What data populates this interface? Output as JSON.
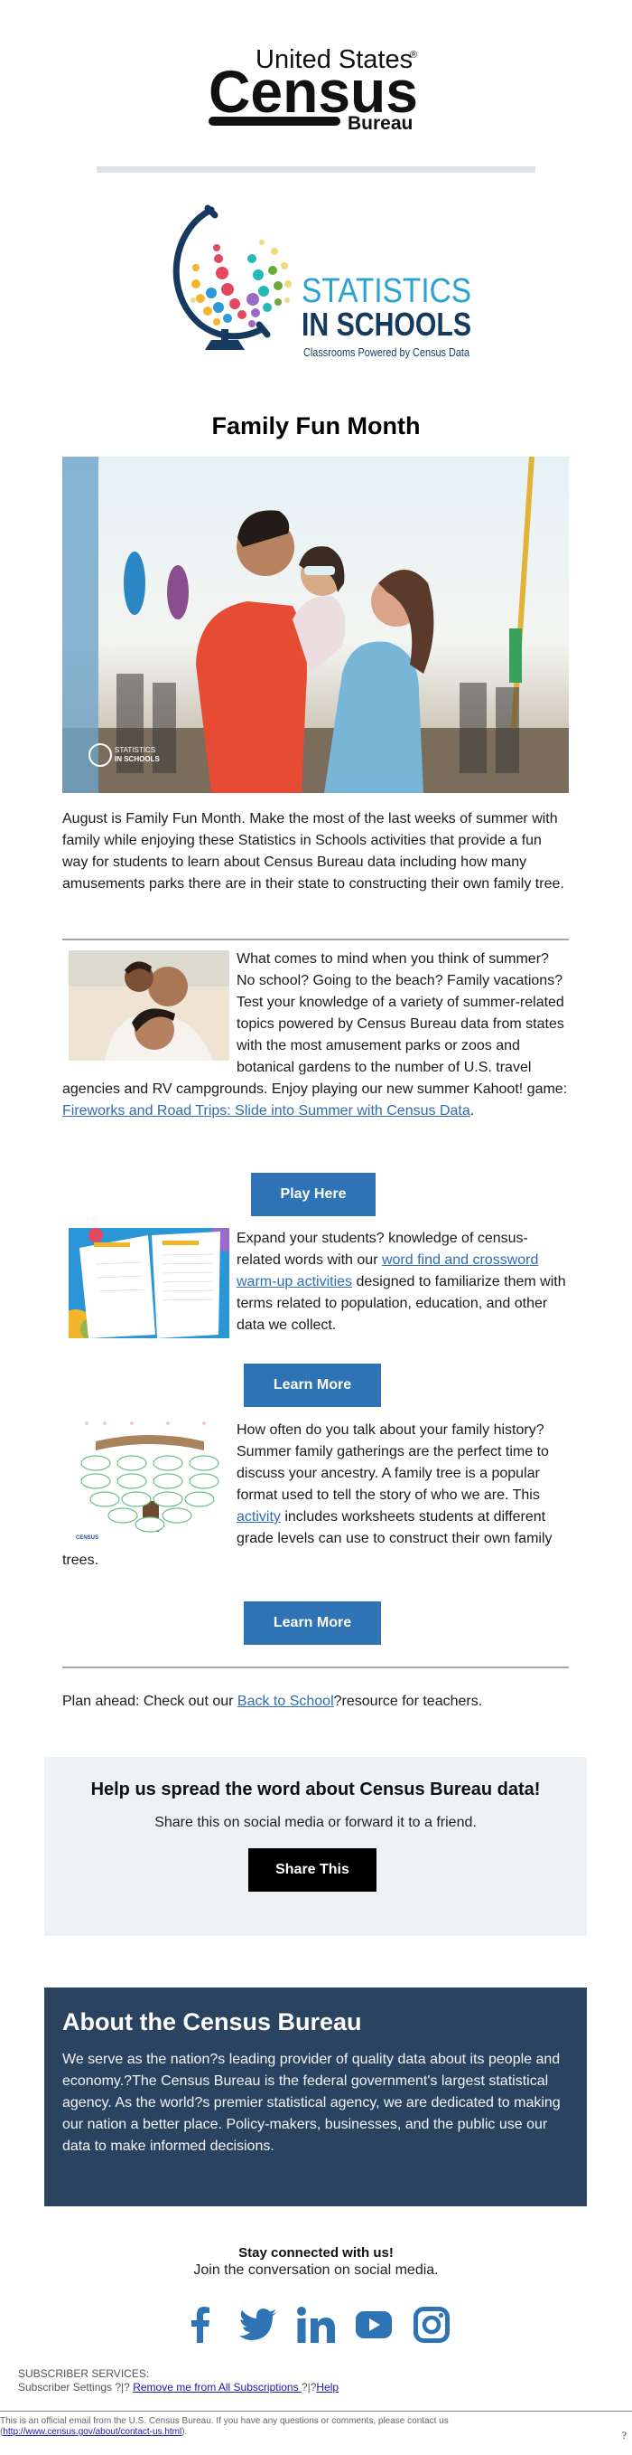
{
  "header": {
    "census_logo": {
      "line1": "United States",
      "registered": "®",
      "line2": "Census",
      "line3": "Bureau"
    },
    "sis_logo": {
      "line1": "STATISTICS",
      "line2": "IN SCHOOLS",
      "tagline": "Classrooms Powered by Census Data"
    }
  },
  "headline": "Family Fun Month",
  "hero": {
    "alt": "Family laughing together at an amusement park",
    "watermark_line1": "STATISTICS",
    "watermark_line2": "IN SCHOOLS"
  },
  "intro": "August is Family Fun Month. Make the most of the last weeks of summer with family while enjoying these Statistics in Schools activities that provide a fun way for students to learn about Census Bureau data including how many amusements parks there are in their state to constructing their own family tree.",
  "features": [
    {
      "image_alt": "Family smiling on the beach",
      "text_before": "What comes to mind when you think of summer? No school? Going to the beach? Family vacations? Test your knowledge of a variety of summer-related topics powered by Census Bureau data from states with the most amusement parks or zoos and botanical gardens to the number of U.S. travel agencies and RV campgrounds. Enjoy playing our new summer Kahoot! game: ",
      "link_text": "Fireworks and Road Trips: Slide into Summer with Census Data",
      "text_after": ".",
      "button_label": "Play Here"
    },
    {
      "image_alt": "Word find and crossword worksheets",
      "text_before": "Expand your students? knowledge of census-related words with our ",
      "link_text": "word find and crossword warm-up activities",
      "text_after": " designed to familiarize them with terms related to population, education, and other data we collect.",
      "button_label": "Learn More"
    },
    {
      "image_alt": "Family tree worksheet",
      "text_before": "How often do you talk about your family history? Summer family gatherings are the perfect time to discuss your ancestry. A family tree is a popular format used to tell the story of who we are. This ",
      "link_text": "activity",
      "text_after": " includes worksheets students at different grade levels can use to construct their own family trees.",
      "button_label": "Learn More"
    }
  ],
  "plan_ahead": {
    "text_before": "Plan ahead: Check out our ",
    "link_text": "Back to School",
    "text_after": "?resource for teachers."
  },
  "share": {
    "title": "Help us spread the word about Census Bureau data!",
    "subtitle": "Share this on social media or forward it to a friend.",
    "button_label": "Share This"
  },
  "about": {
    "title": "About the Census Bureau",
    "body": "We serve as the nation?s leading provider of quality data about its people and economy.?The Census Bureau is the federal government's largest statistical agency. As the world?s premier statistical agency, we are dedicated to making our nation a better place. Policy-makers, businesses, and the public use our data to make informed decisions."
  },
  "stay_connected": {
    "title": "Stay connected with us!",
    "subtitle": "Join the conversation on social media."
  },
  "social": [
    {
      "name": "facebook-icon"
    },
    {
      "name": "twitter-icon"
    },
    {
      "name": "linkedin-icon"
    },
    {
      "name": "youtube-icon"
    },
    {
      "name": "instagram-icon"
    }
  ],
  "subscriber": {
    "heading": "SUBSCRIBER SERVICES:",
    "settings": "Subscriber Settings ?|? ",
    "remove_link": "Remove me from All Subscriptions ",
    "sep": "?|?",
    "help_link": "Help"
  },
  "footer": {
    "text": "This is an official email from the U.S. Census Bureau. If you have any questions or comments, please contact us",
    "paren_open": "(",
    "contact_link": "http://www.census.gov/about/contact-us.html",
    "paren_close": ").",
    "trailing_mark": "?"
  },
  "colors": {
    "button_blue": "#2e74b5",
    "link_blue": "#2e6db4",
    "about_navy": "#2a4361",
    "share_bg": "#eef2f5",
    "social_blue": "#2e74b5",
    "sis_cyan": "#2aa3d0",
    "sis_navy": "#163a5f"
  }
}
